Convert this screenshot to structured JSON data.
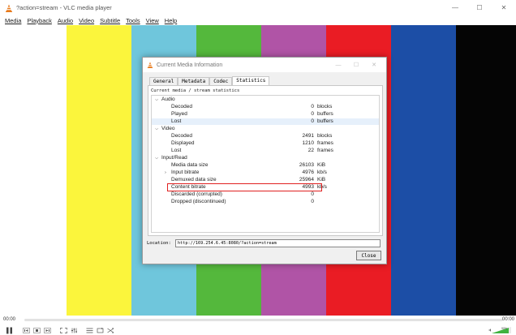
{
  "window": {
    "title": "?action=stream - VLC media player",
    "controls": [
      "—",
      "☐",
      "✕"
    ]
  },
  "menu": [
    "Media",
    "Playback",
    "Audio",
    "Video",
    "Subtitle",
    "Tools",
    "View",
    "Help"
  ],
  "colors": {
    "accent_orange": "#e8791a",
    "bars": [
      "#ffffff",
      "#fbf53c",
      "#6fc6dc",
      "#54b83c",
      "#b054a6",
      "#ea1c24",
      "#1c4ea6",
      "#050505"
    ]
  },
  "dialog": {
    "title": "Current Media Information",
    "tabs": [
      "General",
      "Metadata",
      "Codec",
      "Statistics"
    ],
    "active_tab": "Statistics",
    "caption": "Current media / stream statistics",
    "groups": {
      "audio": {
        "label": "Audio",
        "rows": [
          {
            "label": "Decoded",
            "value": "0",
            "unit": "blocks"
          },
          {
            "label": "Played",
            "value": "0",
            "unit": "buffers"
          },
          {
            "label": "Lost",
            "value": "0",
            "unit": "buffers"
          }
        ]
      },
      "video": {
        "label": "Video",
        "rows": [
          {
            "label": "Decoded",
            "value": "2491",
            "unit": "blocks"
          },
          {
            "label": "Displayed",
            "value": "1210",
            "unit": "frames"
          },
          {
            "label": "Lost",
            "value": "22",
            "unit": "frames"
          }
        ]
      },
      "input": {
        "label": "Input/Read",
        "rows": [
          {
            "label": "Media data size",
            "value": "26103",
            "unit": "KiB"
          },
          {
            "label": "Input bitrate",
            "value": "4976",
            "unit": "kb/s"
          },
          {
            "label": "Demuxed data size",
            "value": "25964",
            "unit": "KiB"
          },
          {
            "label": "Content bitrate",
            "value": "4993",
            "unit": "kb/s"
          },
          {
            "label": "Discarded (corrupted)",
            "value": "0",
            "unit": ""
          },
          {
            "label": "Dropped (discontinued)",
            "value": "0",
            "unit": ""
          }
        ]
      }
    },
    "location_label": "Location:",
    "location_value": "http://169.254.6.45:8080/?action=stream",
    "close_label": "Close"
  },
  "player": {
    "time_elapsed": "00:00",
    "time_total": "00:00",
    "volume_level": "90%"
  }
}
